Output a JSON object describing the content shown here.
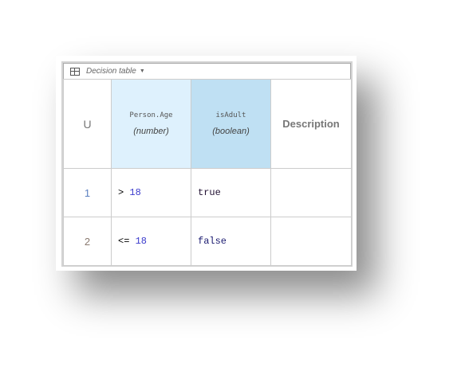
{
  "header": {
    "icon": "table-icon",
    "title": "Decision table"
  },
  "hit_policy": "U",
  "columns": [
    {
      "name": "Person.Age",
      "type": "(number)"
    },
    {
      "name": "isAdult",
      "type": "(boolean)"
    }
  ],
  "description_label": "Description",
  "rows": [
    {
      "num": "1",
      "op": ">",
      "val": "18",
      "out": "true",
      "desc": ""
    },
    {
      "num": "2",
      "op": "<=",
      "val": "18",
      "out": "false",
      "desc": ""
    }
  ],
  "colors": {
    "input_header": "#def1fd",
    "output_header": "#bfe0f3"
  }
}
